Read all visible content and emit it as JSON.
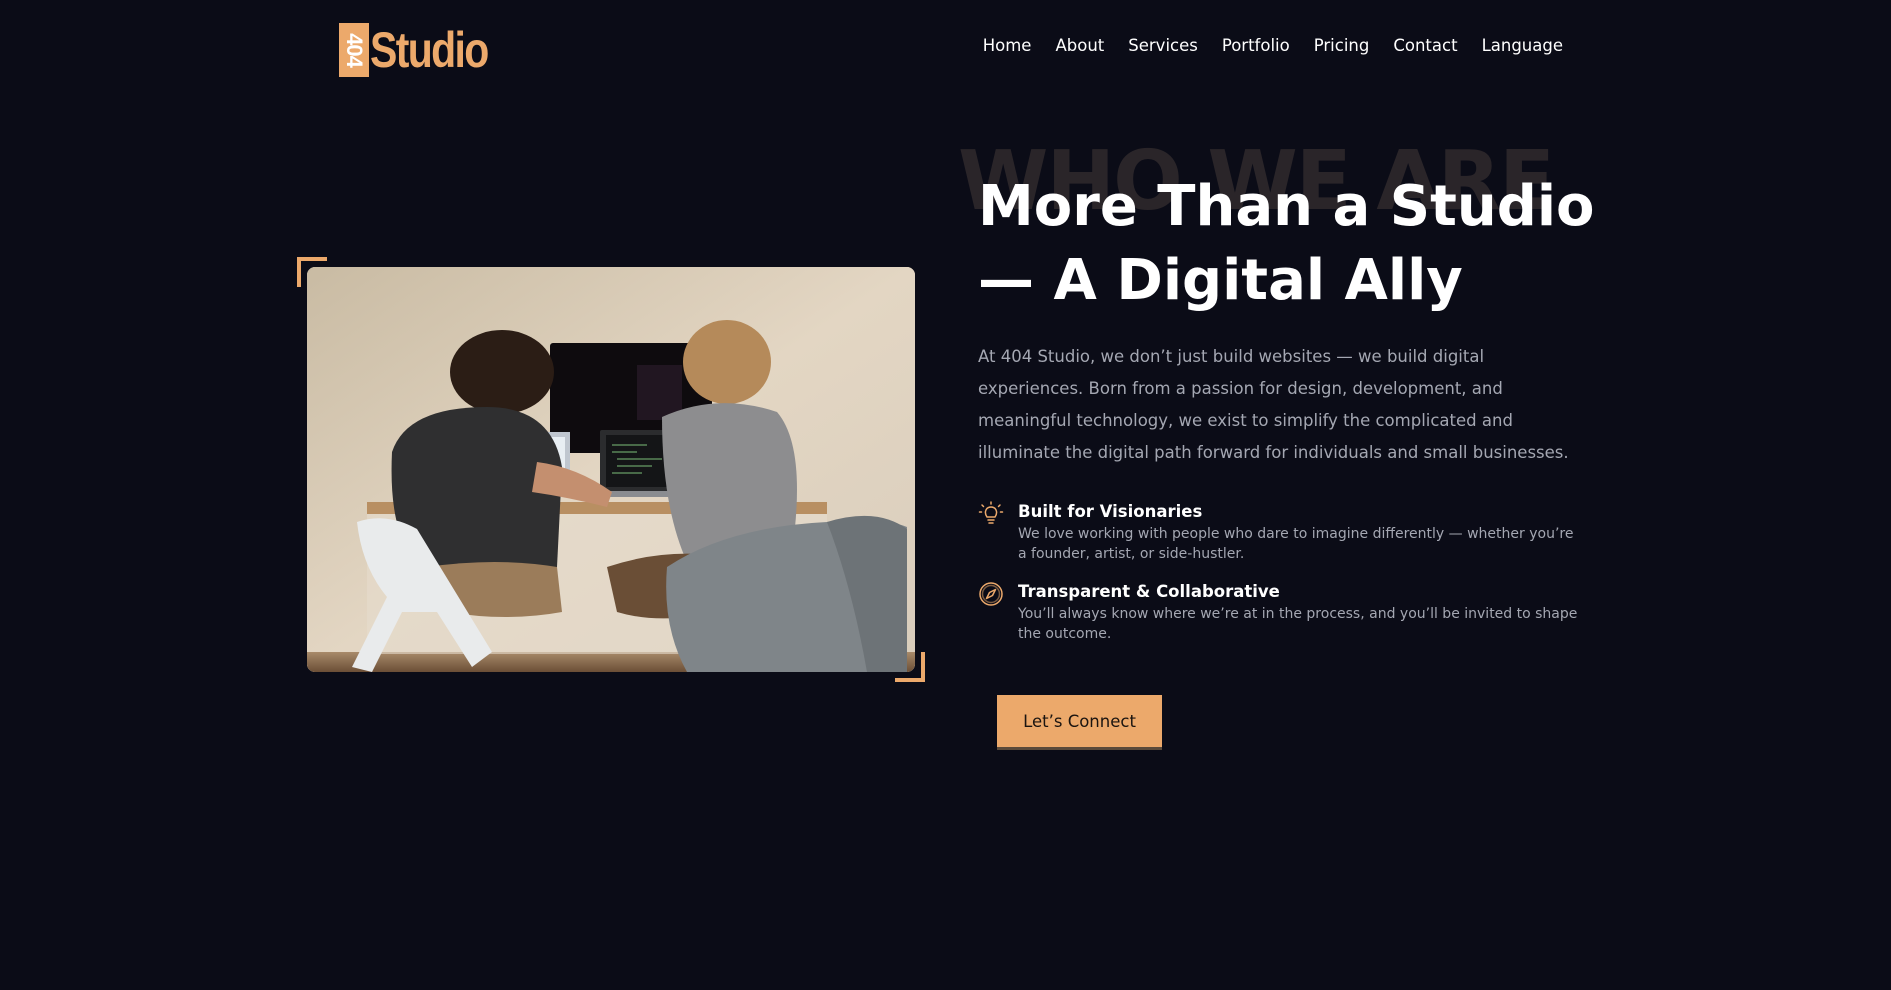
{
  "brand": {
    "logo_box_text": "404",
    "logo_word": "Studio",
    "accent_color": "#eca96b",
    "background_color": "#0b0c17"
  },
  "nav": {
    "items": [
      {
        "label": "Home"
      },
      {
        "label": "About"
      },
      {
        "label": "Services"
      },
      {
        "label": "Portfolio"
      },
      {
        "label": "Pricing"
      },
      {
        "label": "Contact"
      },
      {
        "label": "Language"
      }
    ]
  },
  "hero": {
    "ghost_text": "WHO WE ARE",
    "title_line1": "More Than a Studio",
    "title_line2": "— A Digital Ally",
    "intro": "At 404 Studio, we don’t just build websites — we build digital experiences. Born from a passion for design, development, and meaningful technology, we exist to simplify the complicated and illuminate the digital path forward for individuals and small businesses.",
    "photo_icon": "team-working-at-desk-photo"
  },
  "features": [
    {
      "icon": "lightbulb-icon",
      "title": "Built for Visionaries",
      "desc": "We love working with people who dare to imagine differently — whether you’re a founder, artist, or side-hustler."
    },
    {
      "icon": "compass-icon",
      "title": "Transparent & Collaborative",
      "desc": "You’ll always know where we’re at in the process, and you’ll be invited to shape the outcome."
    }
  ],
  "cta": {
    "label": "Let’s Connect"
  }
}
